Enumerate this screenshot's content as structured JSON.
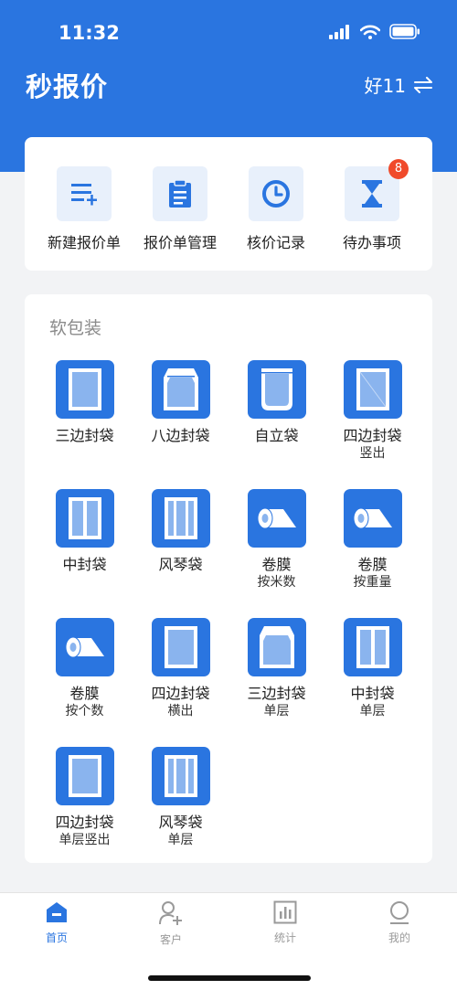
{
  "status": {
    "time": "11:32"
  },
  "header": {
    "title": "秒报价",
    "user": "好11"
  },
  "quick_actions": [
    {
      "label": "新建报价单",
      "icon": "new-list-icon"
    },
    {
      "label": "报价单管理",
      "icon": "clipboard-icon"
    },
    {
      "label": "核价记录",
      "icon": "clock-icon"
    },
    {
      "label": "待办事项",
      "icon": "hourglass-icon",
      "badge": "8"
    }
  ],
  "section": {
    "title": "软包装"
  },
  "products": [
    {
      "name": "三边封袋",
      "sub": "",
      "icon": "three-side-seal-bag-icon"
    },
    {
      "name": "八边封袋",
      "sub": "",
      "icon": "eight-side-seal-bag-icon"
    },
    {
      "name": "自立袋",
      "sub": "",
      "icon": "stand-up-pouch-icon"
    },
    {
      "name": "四边封袋",
      "sub": "竖出",
      "icon": "four-side-seal-bag-icon"
    },
    {
      "name": "中封袋",
      "sub": "",
      "icon": "center-seal-bag-icon"
    },
    {
      "name": "风琴袋",
      "sub": "",
      "icon": "gusset-bag-icon"
    },
    {
      "name": "卷膜",
      "sub": "按米数",
      "icon": "film-roll-icon"
    },
    {
      "name": "卷膜",
      "sub": "按重量",
      "icon": "film-roll-icon"
    },
    {
      "name": "卷膜",
      "sub": "按个数",
      "icon": "film-roll-icon"
    },
    {
      "name": "四边封袋",
      "sub": "横出",
      "icon": "four-side-seal-bag-icon"
    },
    {
      "name": "三边封袋",
      "sub": "单层",
      "icon": "three-side-seal-bag-icon"
    },
    {
      "name": "中封袋",
      "sub": "单层",
      "icon": "center-seal-bag-icon"
    },
    {
      "name": "四边封袋",
      "sub": "单层竖出",
      "icon": "four-side-seal-bag-icon"
    },
    {
      "name": "风琴袋",
      "sub": "单层",
      "icon": "gusset-bag-icon"
    }
  ],
  "tabs": [
    {
      "label": "首页",
      "icon": "home-icon",
      "active": true
    },
    {
      "label": "客户",
      "icon": "add-user-icon",
      "active": false
    },
    {
      "label": "统计",
      "icon": "bar-chart-icon",
      "active": false
    },
    {
      "label": "我的",
      "icon": "profile-icon",
      "active": false
    }
  ],
  "colors": {
    "primary": "#2a75e0",
    "badge": "#f04a2b"
  }
}
